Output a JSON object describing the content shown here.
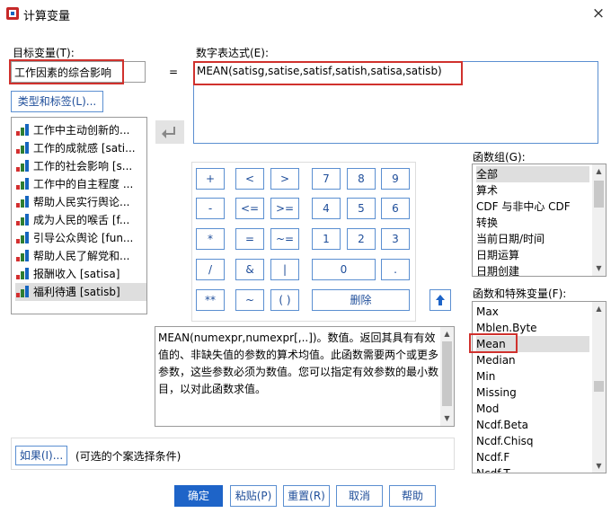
{
  "window": {
    "title": "计算变量",
    "close_glyph": "×"
  },
  "target": {
    "label": "目标变量(T):",
    "value": "工作因素的综合影响",
    "equals": "="
  },
  "type_label_button": "类型和标签(L)...",
  "expression": {
    "label": "数字表达式(E):",
    "value": "MEAN(satisg,satise,satisf,satish,satisa,satisb)"
  },
  "variables": [
    {
      "label": "工作中主动创新的..."
    },
    {
      "label": "工作的成就感 [sati..."
    },
    {
      "label": "工作的社会影响 [s..."
    },
    {
      "label": "工作中的自主程度 ..."
    },
    {
      "label": "帮助人民实行舆论..."
    },
    {
      "label": "成为人民的喉舌 [f..."
    },
    {
      "label": "引导公众舆论 [fun..."
    },
    {
      "label": "帮助人民了解党和..."
    },
    {
      "label": "报酬收入 [satisa]"
    },
    {
      "label": "福利待遇 [satisb]"
    }
  ],
  "keypad": {
    "plus": "+",
    "lt": "<",
    "gt": ">",
    "seven": "7",
    "eight": "8",
    "nine": "9",
    "minus": "-",
    "le": "<=",
    "ge": ">=",
    "four": "4",
    "five": "5",
    "six": "6",
    "mul": "*",
    "eq": "=",
    "ne": "~=",
    "one": "1",
    "two": "2",
    "three": "3",
    "div": "/",
    "and": "&",
    "or": "|",
    "zero": "0",
    "dot": ".",
    "pow": "**",
    "not": "~",
    "paren": "( )",
    "delete": "删除"
  },
  "function_groups": {
    "label": "函数组(G):",
    "items": [
      "全部",
      "算术",
      "CDF 与非中心 CDF",
      "转换",
      "当前日期/时间",
      "日期运算",
      "日期创建"
    ],
    "selected": 0
  },
  "functions": {
    "label": "函数和特殊变量(F):",
    "items": [
      "Max",
      "Mblen.Byte",
      "Mean",
      "Median",
      "Min",
      "Missing",
      "Mod",
      "Ncdf.Beta",
      "Ncdf.Chisq",
      "Ncdf.F",
      "Ncdf.T"
    ],
    "selected": 2
  },
  "description": "MEAN(numexpr,numexpr[,..])。数值。返回其具有有效值的、非缺失值的参数的算术均值。此函数需要两个或更多参数，这些参数必须为数值。您可以指定有效参数的最小数目，以对此函数求值。",
  "if_button": "如果(I)...",
  "if_hint": "(可选的个案选择条件)",
  "buttons": {
    "ok": "确定",
    "paste": "粘贴(P)",
    "reset": "重置(R)",
    "cancel": "取消",
    "help": "帮助"
  },
  "colors": {
    "accent": "#1e64c8",
    "highlight": "#d0312d"
  }
}
